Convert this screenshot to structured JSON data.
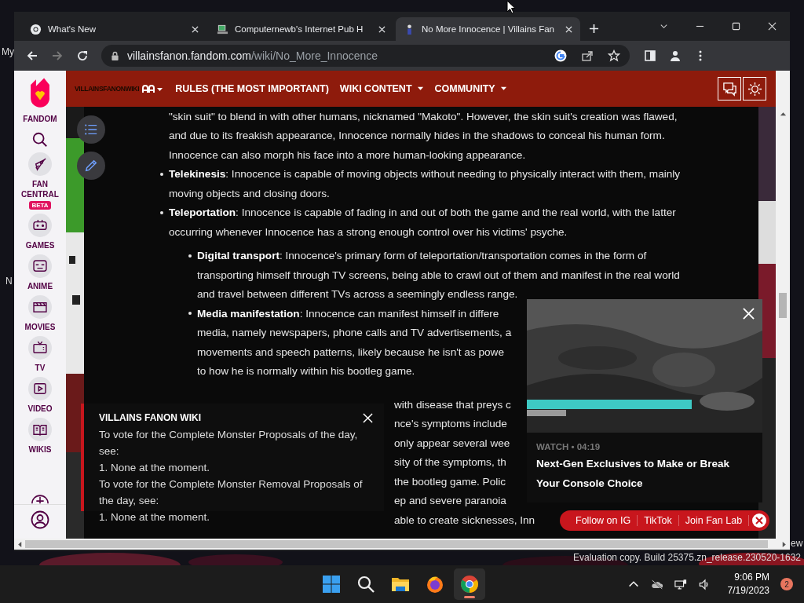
{
  "desktop": {
    "icon_labels": [
      "My",
      "N"
    ],
    "edge_text": "ew",
    "build_note": "Evaluation copy. Build 25375.zn_release.230520-1632"
  },
  "browser": {
    "tabs": [
      {
        "title": "What's New",
        "selected": false
      },
      {
        "title": "Computernewb's Internet Pub H",
        "selected": false
      },
      {
        "title": "No More Innocence | Villains Fan",
        "selected": true
      }
    ],
    "url": {
      "host": "villainsfanon.fandom.com",
      "path": "/wiki/No_More_Innocence"
    }
  },
  "fandom_sidebar": {
    "brand": "FANDOM",
    "items": [
      {
        "label": "FAN CENTRAL",
        "kind": "rocket",
        "badge": "BETA"
      },
      {
        "label": "GAMES",
        "kind": "gamepad"
      },
      {
        "label": "ANIME",
        "kind": "face"
      },
      {
        "label": "MOVIES",
        "kind": "clapper"
      },
      {
        "label": "TV",
        "kind": "tv"
      },
      {
        "label": "VIDEO",
        "kind": "play"
      },
      {
        "label": "WIKIS",
        "kind": "book"
      }
    ]
  },
  "wiki_bar": {
    "wordmark": "VILLAINSFANONWIKI",
    "menu": [
      "RULES (THE MOST IMPORTANT)",
      "WIKI CONTENT",
      "COMMUNITY"
    ]
  },
  "article": {
    "lines": [
      {
        "kind": "para",
        "text": "\"skin suit\" to blend in with other humans, nicknamed \"Makoto\". However, the skin suit's creation was flawed,"
      },
      {
        "kind": "para",
        "text": "and due to its freakish appearance, Innocence normally hides in the shadows to conceal his human form."
      },
      {
        "kind": "para",
        "text": "Innocence can also morph his face into a more human-looking appearance."
      },
      {
        "kind": "bullet",
        "text": "**Telekinesis**: Innocence is capable of moving objects without needing to physically interact with them, mainly"
      },
      {
        "kind": "cont",
        "text": "moving objects and closing doors."
      },
      {
        "kind": "bullet",
        "text": "**Teleportation**: Innocence is capable of fading in and out of both the game and the real world, with the latter"
      },
      {
        "kind": "cont",
        "text": "occurring whenever Innocence has a strong enough control over his victims' psyche."
      },
      {
        "kind": "sub",
        "text": "**Digital transport**: Innocence's primary form of teleportation/transportation comes in the form of"
      },
      {
        "kind": "subcont",
        "text": "transporting himself through TV screens, being able to crawl out of them and manifest in the real world"
      },
      {
        "kind": "subcont",
        "text": "and travel between different TVs across a seemingly endless range."
      },
      {
        "kind": "sub",
        "text": "**Media manifestation**: Innocence can manifest himself in differe"
      },
      {
        "kind": "subcont",
        "text": "media, namely newspapers, phone calls and TV advertisements, a"
      },
      {
        "kind": "subcont",
        "text": "movements and speech patterns, likely because he isn't as powe"
      },
      {
        "kind": "subcont",
        "text": "to how he is normally within his bootleg game."
      },
      {
        "kind": "frag",
        "text": "with disease that preys c"
      },
      {
        "kind": "frag",
        "text": "nce's symptoms include"
      },
      {
        "kind": "frag",
        "text": "only appear several wee"
      },
      {
        "kind": "frag",
        "text": "sity of the symptoms, th"
      },
      {
        "kind": "frag",
        "text": "the bootleg game. Polic"
      },
      {
        "kind": "frag",
        "text": "ep and severe paranoia"
      },
      {
        "kind": "frag",
        "text": "able to create sicknesses, Inn"
      }
    ]
  },
  "notice": {
    "title": "VILLAINS FANON WIKI",
    "lines": [
      "To vote for the Complete Monster Proposals of the day, see:",
      "1. None at the moment.",
      "To vote for the Complete Monster Removal Proposals of the day, see:",
      "1. None at the moment."
    ]
  },
  "video": {
    "meta": "WATCH • 04:19",
    "title": "Next-Gen Exclusives to Make or Break Your Console Choice"
  },
  "social": [
    "Follow on IG",
    "TikTok",
    "Join Fan Lab"
  ],
  "taskbar": {
    "apps": [
      {
        "kind": "start",
        "selected": false
      },
      {
        "kind": "search",
        "selected": false
      },
      {
        "kind": "folder",
        "selected": false
      },
      {
        "kind": "firefox",
        "selected": false
      },
      {
        "kind": "chrome",
        "selected": true
      }
    ],
    "time": "9:06 PM",
    "date": "7/19/2023",
    "notifications": "2"
  }
}
